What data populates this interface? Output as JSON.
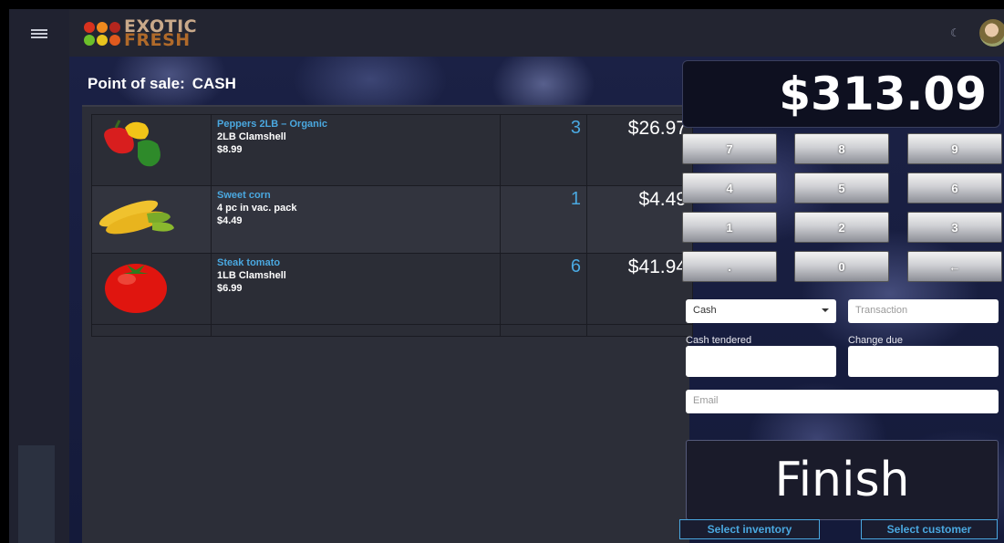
{
  "app": {
    "logo_line1": "EXOTIC",
    "logo_line2": "FRESH"
  },
  "header": {
    "theme_icon": "moon-icon",
    "avatar": "user-avatar"
  },
  "page": {
    "title_prefix": "Point of sale:",
    "title_mode": "CASH"
  },
  "cart": {
    "items": [
      {
        "name": "Peppers 2LB – Organic",
        "package": "2LB Clamshell",
        "unit_price": "$8.99",
        "qty": "3",
        "total": "$26.97",
        "image": "bell-peppers"
      },
      {
        "name": "Sweet corn",
        "package": "4 pc in vac. pack",
        "unit_price": "$4.49",
        "qty": "1",
        "total": "$4.49",
        "image": "sweet-corn"
      },
      {
        "name": "Steak tomato",
        "package": "1LB Clamshell",
        "unit_price": "$6.99",
        "qty": "6",
        "total": "$41.94",
        "image": "tomato"
      }
    ]
  },
  "payment": {
    "total": "$313.09",
    "keypad": [
      "7",
      "8",
      "9",
      "4",
      "5",
      "6",
      "1",
      "2",
      "3",
      ".",
      "0",
      "←"
    ],
    "method_value": "Cash",
    "transaction_placeholder": "Transaction",
    "cash_tendered_label": "Cash tendered",
    "change_due_label": "Change due",
    "email_placeholder": "Email",
    "finish_label": "Finish"
  },
  "footer": {
    "select_inventory": "Select inventory",
    "select_customer": "Select customer"
  },
  "colors": {
    "accent": "#4aa8e0",
    "background": "#232531"
  }
}
